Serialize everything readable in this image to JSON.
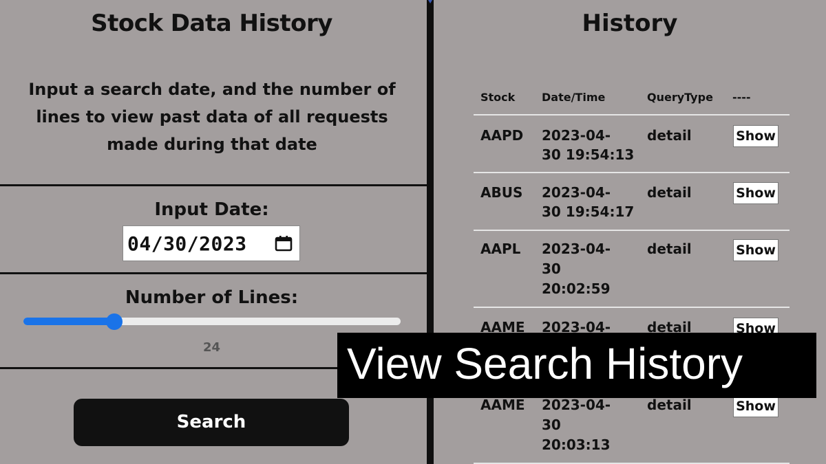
{
  "left_panel": {
    "title": "Stock Data History",
    "description": "Input a search date, and the number of lines to view past data of all requests made during that date",
    "date_label": "Input Date:",
    "date_value": "04/30/2023",
    "lines_label": "Number of Lines:",
    "lines_value": "24",
    "lines_fraction": 0.24,
    "search_label": "Search"
  },
  "right_panel": {
    "title": "History",
    "headers": [
      "Stock",
      "Date/Time",
      "QueryType",
      "----"
    ],
    "rows": [
      {
        "stock": "AAPD",
        "dt_line1": "2023-04-",
        "dt_line2": "30 19:54:13",
        "dt_line3": "",
        "type": "detail",
        "action": "Show"
      },
      {
        "stock": "ABUS",
        "dt_line1": "2023-04-",
        "dt_line2": "30 19:54:17",
        "dt_line3": "",
        "type": "detail",
        "action": "Show"
      },
      {
        "stock": "AAPL",
        "dt_line1": "2023-04-",
        "dt_line2": "30",
        "dt_line3": "20:02:59",
        "type": "detail",
        "action": "Show"
      },
      {
        "stock": "AAME",
        "dt_line1": "2023-04-",
        "dt_line2": "",
        "dt_line3": "",
        "type": "detail",
        "action": "Show"
      },
      {
        "stock": "AAME",
        "dt_line1": "2023-04-",
        "dt_line2": "30",
        "dt_line3": "20:03:13",
        "type": "detail",
        "action": "Show"
      }
    ]
  },
  "banner": {
    "text": "View Search History"
  },
  "colors": {
    "background": "#a39e9e",
    "slider_accent": "#1a73e8",
    "divider": "#0f0f0f"
  }
}
